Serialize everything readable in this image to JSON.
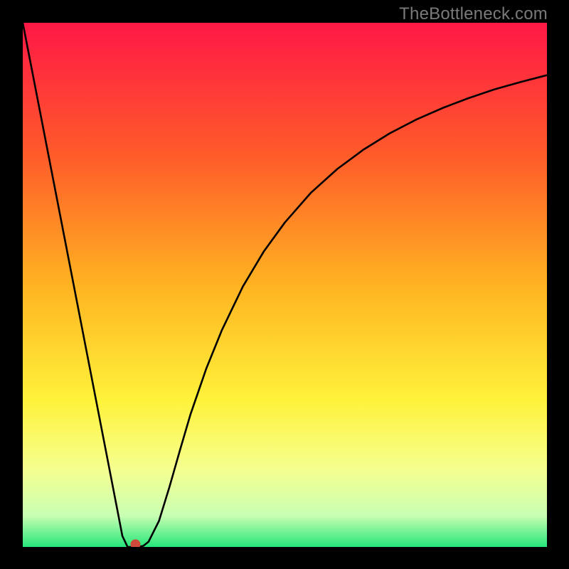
{
  "watermark": "TheBottleneck.com",
  "chart_data": {
    "type": "line",
    "title": "",
    "xlabel": "",
    "ylabel": "",
    "xlim": [
      0,
      100
    ],
    "ylim": [
      0,
      100
    ],
    "gradient_stops": [
      {
        "offset": 0,
        "color": "#ff1846"
      },
      {
        "offset": 25,
        "color": "#ff5a2a"
      },
      {
        "offset": 50,
        "color": "#ffb321"
      },
      {
        "offset": 72,
        "color": "#fff23a"
      },
      {
        "offset": 85,
        "color": "#f6ff8f"
      },
      {
        "offset": 94,
        "color": "#c9ffb3"
      },
      {
        "offset": 100,
        "color": "#26e67a"
      }
    ],
    "series": [
      {
        "name": "bottleneck-curve",
        "type": "line",
        "color": "#000000",
        "x": [
          0,
          2,
          4,
          6,
          8,
          10,
          12,
          14,
          16,
          18,
          19,
          20,
          21,
          22,
          23,
          24,
          26,
          28,
          30,
          32,
          35,
          38,
          42,
          46,
          50,
          55,
          60,
          65,
          70,
          75,
          80,
          85,
          90,
          95,
          100
        ],
        "values": [
          100,
          89.7,
          79.4,
          69.1,
          58.8,
          48.5,
          38.2,
          27.9,
          17.6,
          7.3,
          2.1,
          0,
          0,
          0,
          0.2,
          1.0,
          5.0,
          11.5,
          18.5,
          25.3,
          34.0,
          41.4,
          49.7,
          56.4,
          61.9,
          67.6,
          72.1,
          75.8,
          78.9,
          81.5,
          83.7,
          85.6,
          87.3,
          88.7,
          90.0
        ]
      }
    ],
    "marker": {
      "x": 21.5,
      "y": 0.5,
      "color": "#d24a3a",
      "radius": 7
    }
  }
}
